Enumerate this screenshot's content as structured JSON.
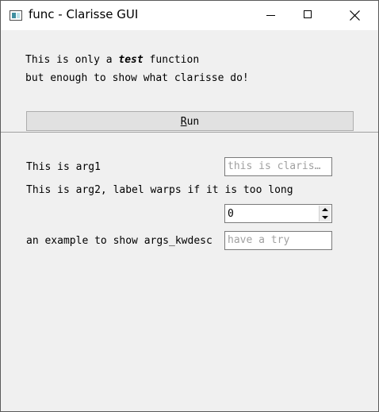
{
  "window": {
    "title": "func - Clarisse GUI",
    "icon": "app-window-icon",
    "controls": {
      "minimize": "minimize-icon",
      "maximize": "maximize-icon",
      "close": "close-icon"
    }
  },
  "description": {
    "line1_prefix": "This is only a ",
    "line1_emphasis": "test",
    "line1_suffix": " function",
    "line2": "but enough to show what clarisse do!"
  },
  "run_button": {
    "mnemonic": "R",
    "rest": "un"
  },
  "args": [
    {
      "label": "This is arg1",
      "placeholder": "this is claris…"
    },
    {
      "label": "This is arg2, label warps if it is too long",
      "value": "0"
    },
    {
      "label": "an example to show args_kwdesc",
      "placeholder": "have a try"
    }
  ],
  "colors": {
    "window_bg": "#f0f0f0",
    "titlebar_bg": "#ffffff",
    "placeholder_text": "#a0a0a0"
  }
}
